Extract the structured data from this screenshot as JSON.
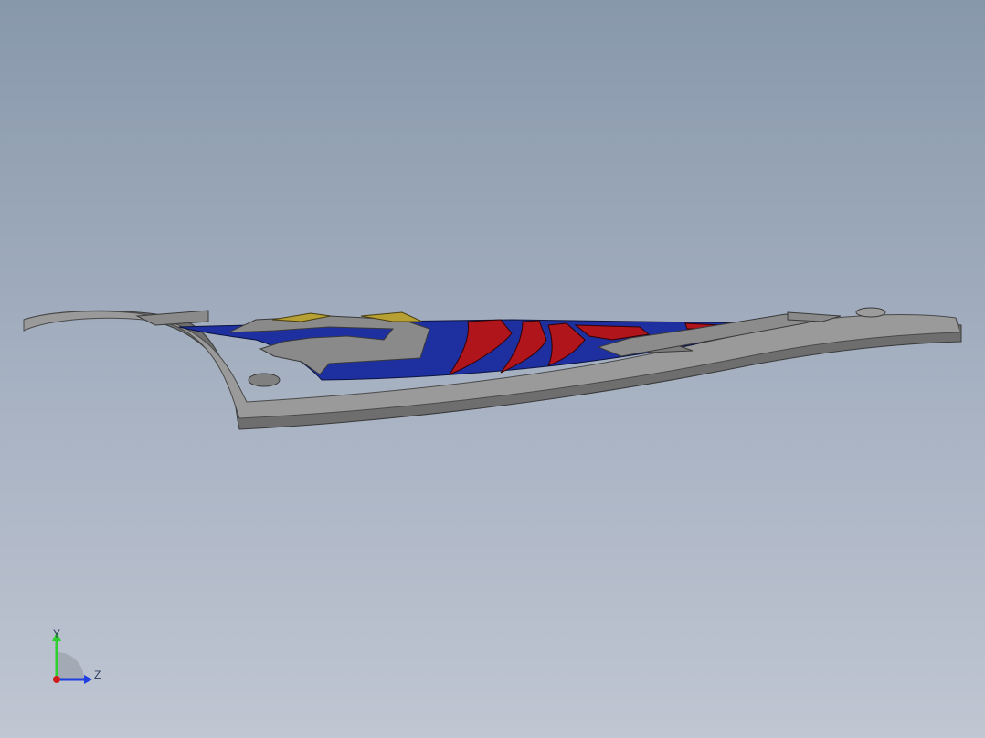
{
  "viewport": {
    "background_top": "#8898ab",
    "background_bottom": "#c0c6d2"
  },
  "model": {
    "frame_color": "#8f8f8f",
    "field_color": "#1e2fa0",
    "emblem_color": "#b0151c",
    "accent_color": "#b7a033"
  },
  "triad": {
    "y_label": "Y",
    "z_label": "Z",
    "y_color": "#2fcf2f",
    "z_color": "#1f3fe0",
    "x_color": "#d01c1c"
  }
}
